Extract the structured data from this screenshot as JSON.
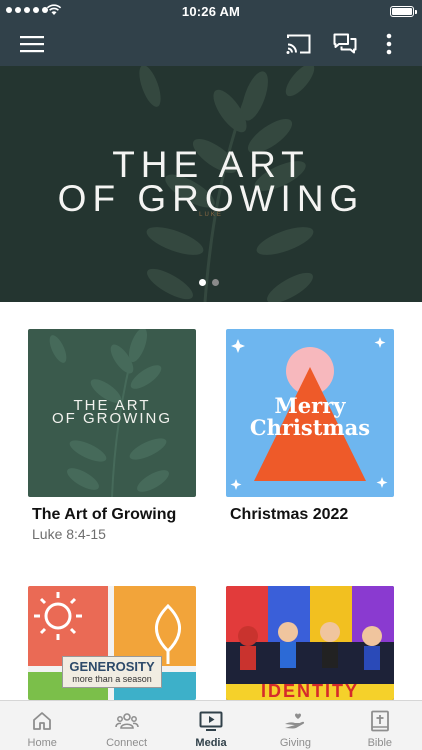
{
  "status_bar": {
    "time": "10:26 AM"
  },
  "app_bar": {
    "menu_icon": "hamburger-menu-icon",
    "actions": [
      "cast-icon",
      "chat-icon",
      "more-vertical-icon"
    ]
  },
  "hero": {
    "title_line1": "THE ART",
    "title_line2": "OF GROWING",
    "subtitle": "LUKE",
    "pager": {
      "count": 2,
      "active_index": 0
    }
  },
  "cards": [
    {
      "title": "The Art of Growing",
      "subtitle": "Luke 8:4-15",
      "thumb_line1": "THE ART",
      "thumb_line2": "OF GROWING"
    },
    {
      "title": "Christmas 2022",
      "subtitle": "",
      "thumb_line1": "Merry",
      "thumb_line2": "Christmas"
    },
    {
      "title": "",
      "subtitle": "",
      "thumb_line1": "GENEROSITY",
      "thumb_line2": "more than a season"
    },
    {
      "title": "",
      "subtitle": "",
      "thumb_line1": "IDENTITY",
      "thumb_line2": ""
    }
  ],
  "tab_bar": {
    "active": "Media",
    "tabs": [
      {
        "label": "Home",
        "icon": "home-icon"
      },
      {
        "label": "Connect",
        "icon": "people-icon"
      },
      {
        "label": "Media",
        "icon": "video-play-icon"
      },
      {
        "label": "Giving",
        "icon": "giving-hand-icon"
      },
      {
        "label": "Bible",
        "icon": "bible-icon"
      }
    ]
  },
  "colors": {
    "header": "#31414a",
    "hero_bg": "#243530",
    "card1_bg": "#3a5a4c",
    "card2_bg": "#6eb6ef",
    "card2_triangle": "#ee5a29",
    "card2_circle": "#f7b8bd",
    "active_tab": "#31414a",
    "inactive_tab": "#8e8e8e"
  }
}
